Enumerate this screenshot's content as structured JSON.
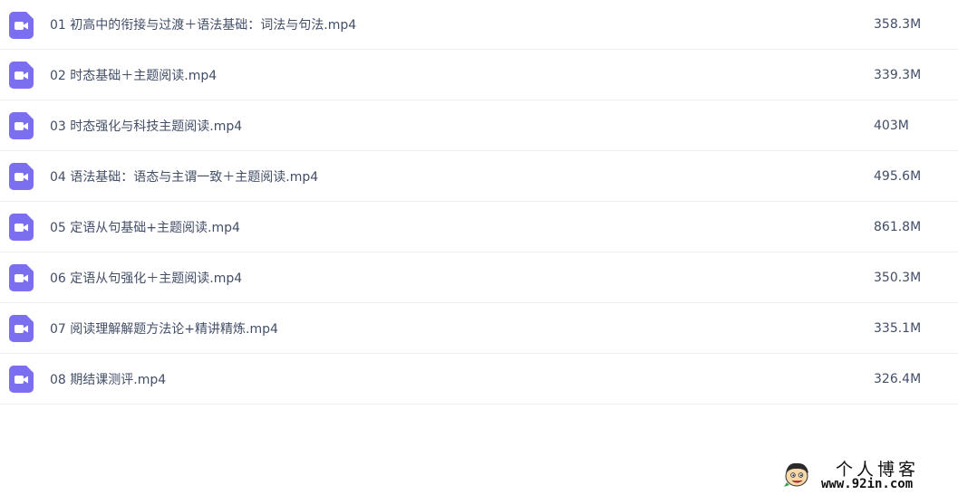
{
  "files": [
    {
      "name": "01 初高中的衔接与过渡＋语法基础：词法与句法.mp4",
      "size": "358.3M",
      "icon": "video-file-icon"
    },
    {
      "name": "02 时态基础＋主题阅读.mp4",
      "size": "339.3M",
      "icon": "video-file-icon"
    },
    {
      "name": "03 时态强化与科技主题阅读.mp4",
      "size": "403M",
      "icon": "video-file-icon"
    },
    {
      "name": "04 语法基础：语态与主谓一致＋主题阅读.mp4",
      "size": "495.6M",
      "icon": "video-file-icon"
    },
    {
      "name": "05 定语从句基础+主题阅读.mp4",
      "size": "861.8M",
      "icon": "video-file-icon"
    },
    {
      "name": "06 定语从句强化＋主题阅读.mp4",
      "size": "350.3M",
      "icon": "video-file-icon"
    },
    {
      "name": "07 阅读理解解题方法论+精讲精炼.mp4",
      "size": "335.1M",
      "icon": "video-file-icon"
    },
    {
      "name": "08 期结课测评.mp4",
      "size": "326.4M",
      "icon": "video-file-icon"
    }
  ],
  "colors": {
    "icon": "#7b6ff0",
    "text": "#424e67",
    "divider": "#eef0f3"
  },
  "watermark": {
    "title": "个人博客",
    "url": "www.92in.com"
  }
}
